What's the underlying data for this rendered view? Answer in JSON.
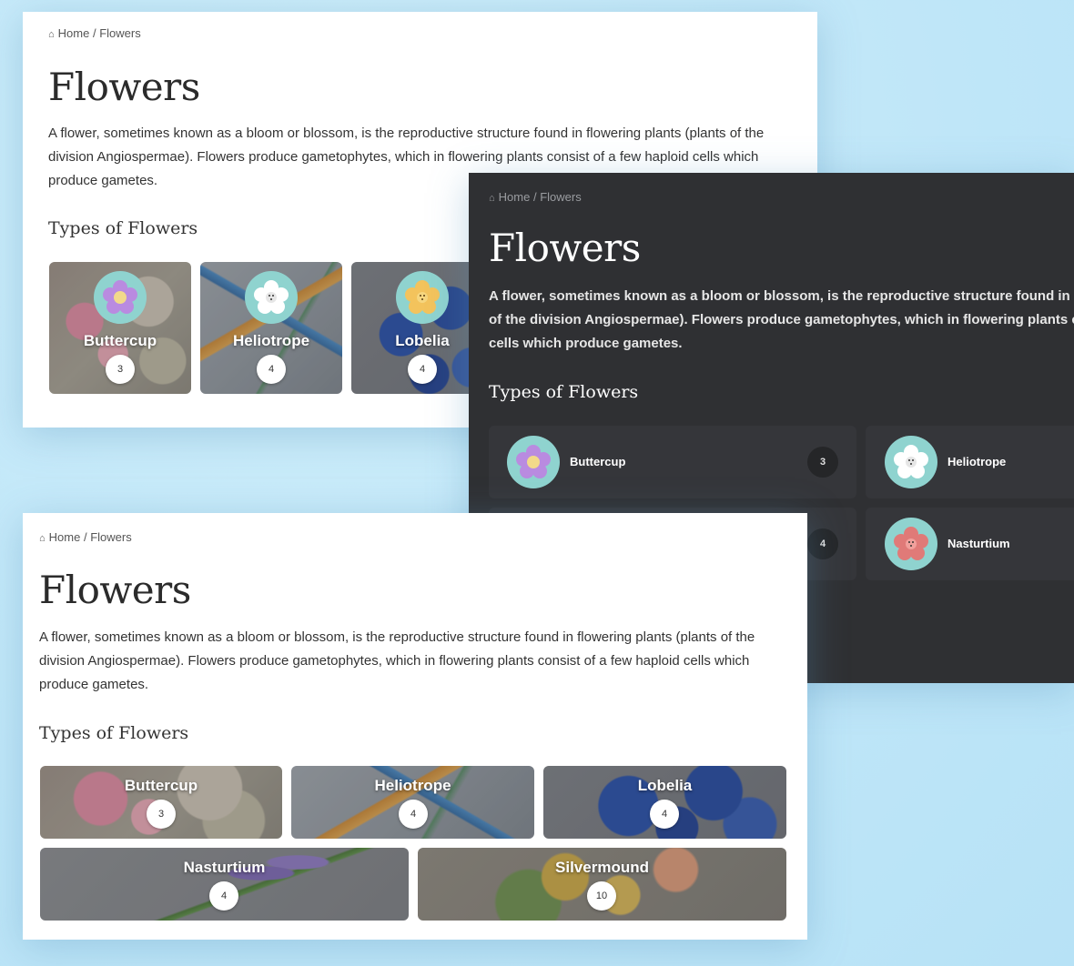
{
  "breadcrumb": {
    "home": "Home",
    "separator": "/",
    "current": "Flowers"
  },
  "title": "Flowers",
  "description": "A flower, sometimes known as a bloom or blossom, is the reproductive structure found in flowering plants (plants of the division Angiospermae). Flowers produce gametophytes, which in flowering plants consist of a few haploid cells which produce gametes.",
  "section_title": "Types of Flowers",
  "flowers": [
    {
      "name": "Buttercup",
      "count": "3",
      "icon_color": "#b98be0",
      "center_color": "#f2d98a"
    },
    {
      "name": "Heliotrope",
      "count": "4",
      "icon_color": "#ffffff",
      "center_color": "#e6e6e6"
    },
    {
      "name": "Lobelia",
      "count": "4",
      "icon_color": "#f3c35c",
      "center_color": "#f6d67f"
    },
    {
      "name": "Nasturtium",
      "count": "4",
      "icon_color": "#e07a78",
      "center_color": "#f1a09c"
    },
    {
      "name": "Silvermound",
      "count": "10"
    }
  ],
  "colors": {
    "icon_bg": "#8fd3cf",
    "dark_bg": "#2f3033",
    "dark_card": "#35363a"
  }
}
